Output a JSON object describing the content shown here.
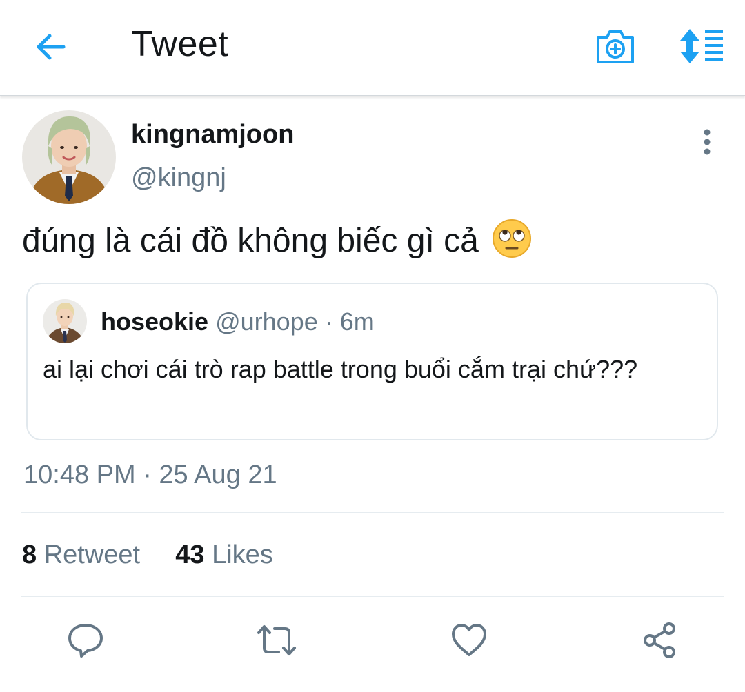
{
  "header": {
    "title": "Tweet",
    "back_icon": "arrow-left-icon",
    "camera_icon": "camera-plus-icon",
    "sort_icon": "sort-list-icon",
    "accent_color": "#1da1f2"
  },
  "tweet": {
    "display_name": "kingnamjoon",
    "handle": "@kingnj",
    "text": "đúng là cái đồ không biếc gì cả",
    "emoji": "face-with-rolling-eyes",
    "timestamp": "10:48 PM · 25 Aug 21"
  },
  "quoted_tweet": {
    "display_name": "hoseokie",
    "handle": "@urhope",
    "separator": " · ",
    "time": "6m",
    "text": "ai lại chơi cái trò rap battle trong buổi cắm trại chứ???"
  },
  "stats": {
    "retweets_count": "8",
    "retweets_label": "Retweet",
    "likes_count": "43",
    "likes_label": "Likes"
  },
  "actions": [
    "reply-icon",
    "retweet-icon",
    "like-icon",
    "share-icon"
  ],
  "colors": {
    "icon_gray": "#657786",
    "text": "#14171a",
    "muted": "#657786"
  }
}
